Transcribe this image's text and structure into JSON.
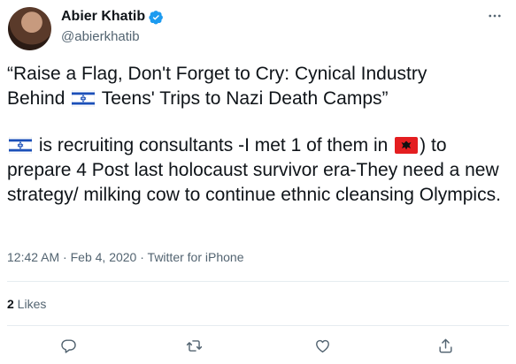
{
  "author": {
    "display_name": "Abier Khatib",
    "handle": "@abierkhatib"
  },
  "tweet": {
    "line1": "“Raise a Flag, Don't Forget to Cry: Cynical Industry",
    "line2_before": "Behind ",
    "line2_after": " Teens' Trips to Nazi Death Camps”",
    "p2_a": " is recruiting consultants -I met 1 of them in ",
    "p2_b": ") to prepare 4 Post last holocaust survivor  era-They need a new strategy/ milking cow to continue ethnic cleansing Olympics."
  },
  "meta": {
    "time": "12:42 AM",
    "sep1": " · ",
    "date": "Feb 4, 2020",
    "sep2": " · ",
    "source": "Twitter for iPhone"
  },
  "stats": {
    "likes_count": "2",
    "likes_label": " Likes"
  },
  "icons": {
    "reply": "reply-icon",
    "retweet": "retweet-icon",
    "like": "like-icon",
    "share": "share-icon",
    "more": "more-icon",
    "verified": "verified-icon"
  },
  "colors": {
    "text": "#0f1419",
    "secondary": "#536471",
    "verified": "#1d9bf0",
    "divider": "#e6ecf0"
  }
}
